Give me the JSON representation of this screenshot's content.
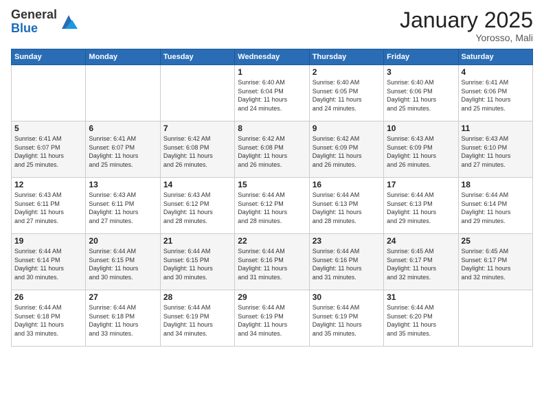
{
  "logo": {
    "general": "General",
    "blue": "Blue"
  },
  "title": "January 2025",
  "location": "Yorosso, Mali",
  "days_header": [
    "Sunday",
    "Monday",
    "Tuesday",
    "Wednesday",
    "Thursday",
    "Friday",
    "Saturday"
  ],
  "weeks": [
    [
      {
        "day": "",
        "info": ""
      },
      {
        "day": "",
        "info": ""
      },
      {
        "day": "",
        "info": ""
      },
      {
        "day": "1",
        "info": "Sunrise: 6:40 AM\nSunset: 6:04 PM\nDaylight: 11 hours\nand 24 minutes."
      },
      {
        "day": "2",
        "info": "Sunrise: 6:40 AM\nSunset: 6:05 PM\nDaylight: 11 hours\nand 24 minutes."
      },
      {
        "day": "3",
        "info": "Sunrise: 6:40 AM\nSunset: 6:06 PM\nDaylight: 11 hours\nand 25 minutes."
      },
      {
        "day": "4",
        "info": "Sunrise: 6:41 AM\nSunset: 6:06 PM\nDaylight: 11 hours\nand 25 minutes."
      }
    ],
    [
      {
        "day": "5",
        "info": "Sunrise: 6:41 AM\nSunset: 6:07 PM\nDaylight: 11 hours\nand 25 minutes."
      },
      {
        "day": "6",
        "info": "Sunrise: 6:41 AM\nSunset: 6:07 PM\nDaylight: 11 hours\nand 25 minutes."
      },
      {
        "day": "7",
        "info": "Sunrise: 6:42 AM\nSunset: 6:08 PM\nDaylight: 11 hours\nand 26 minutes."
      },
      {
        "day": "8",
        "info": "Sunrise: 6:42 AM\nSunset: 6:08 PM\nDaylight: 11 hours\nand 26 minutes."
      },
      {
        "day": "9",
        "info": "Sunrise: 6:42 AM\nSunset: 6:09 PM\nDaylight: 11 hours\nand 26 minutes."
      },
      {
        "day": "10",
        "info": "Sunrise: 6:43 AM\nSunset: 6:09 PM\nDaylight: 11 hours\nand 26 minutes."
      },
      {
        "day": "11",
        "info": "Sunrise: 6:43 AM\nSunset: 6:10 PM\nDaylight: 11 hours\nand 27 minutes."
      }
    ],
    [
      {
        "day": "12",
        "info": "Sunrise: 6:43 AM\nSunset: 6:11 PM\nDaylight: 11 hours\nand 27 minutes."
      },
      {
        "day": "13",
        "info": "Sunrise: 6:43 AM\nSunset: 6:11 PM\nDaylight: 11 hours\nand 27 minutes."
      },
      {
        "day": "14",
        "info": "Sunrise: 6:43 AM\nSunset: 6:12 PM\nDaylight: 11 hours\nand 28 minutes."
      },
      {
        "day": "15",
        "info": "Sunrise: 6:44 AM\nSunset: 6:12 PM\nDaylight: 11 hours\nand 28 minutes."
      },
      {
        "day": "16",
        "info": "Sunrise: 6:44 AM\nSunset: 6:13 PM\nDaylight: 11 hours\nand 28 minutes."
      },
      {
        "day": "17",
        "info": "Sunrise: 6:44 AM\nSunset: 6:13 PM\nDaylight: 11 hours\nand 29 minutes."
      },
      {
        "day": "18",
        "info": "Sunrise: 6:44 AM\nSunset: 6:14 PM\nDaylight: 11 hours\nand 29 minutes."
      }
    ],
    [
      {
        "day": "19",
        "info": "Sunrise: 6:44 AM\nSunset: 6:14 PM\nDaylight: 11 hours\nand 30 minutes."
      },
      {
        "day": "20",
        "info": "Sunrise: 6:44 AM\nSunset: 6:15 PM\nDaylight: 11 hours\nand 30 minutes."
      },
      {
        "day": "21",
        "info": "Sunrise: 6:44 AM\nSunset: 6:15 PM\nDaylight: 11 hours\nand 30 minutes."
      },
      {
        "day": "22",
        "info": "Sunrise: 6:44 AM\nSunset: 6:16 PM\nDaylight: 11 hours\nand 31 minutes."
      },
      {
        "day": "23",
        "info": "Sunrise: 6:44 AM\nSunset: 6:16 PM\nDaylight: 11 hours\nand 31 minutes."
      },
      {
        "day": "24",
        "info": "Sunrise: 6:45 AM\nSunset: 6:17 PM\nDaylight: 11 hours\nand 32 minutes."
      },
      {
        "day": "25",
        "info": "Sunrise: 6:45 AM\nSunset: 6:17 PM\nDaylight: 11 hours\nand 32 minutes."
      }
    ],
    [
      {
        "day": "26",
        "info": "Sunrise: 6:44 AM\nSunset: 6:18 PM\nDaylight: 11 hours\nand 33 minutes."
      },
      {
        "day": "27",
        "info": "Sunrise: 6:44 AM\nSunset: 6:18 PM\nDaylight: 11 hours\nand 33 minutes."
      },
      {
        "day": "28",
        "info": "Sunrise: 6:44 AM\nSunset: 6:19 PM\nDaylight: 11 hours\nand 34 minutes."
      },
      {
        "day": "29",
        "info": "Sunrise: 6:44 AM\nSunset: 6:19 PM\nDaylight: 11 hours\nand 34 minutes."
      },
      {
        "day": "30",
        "info": "Sunrise: 6:44 AM\nSunset: 6:19 PM\nDaylight: 11 hours\nand 35 minutes."
      },
      {
        "day": "31",
        "info": "Sunrise: 6:44 AM\nSunset: 6:20 PM\nDaylight: 11 hours\nand 35 minutes."
      },
      {
        "day": "",
        "info": ""
      }
    ]
  ]
}
